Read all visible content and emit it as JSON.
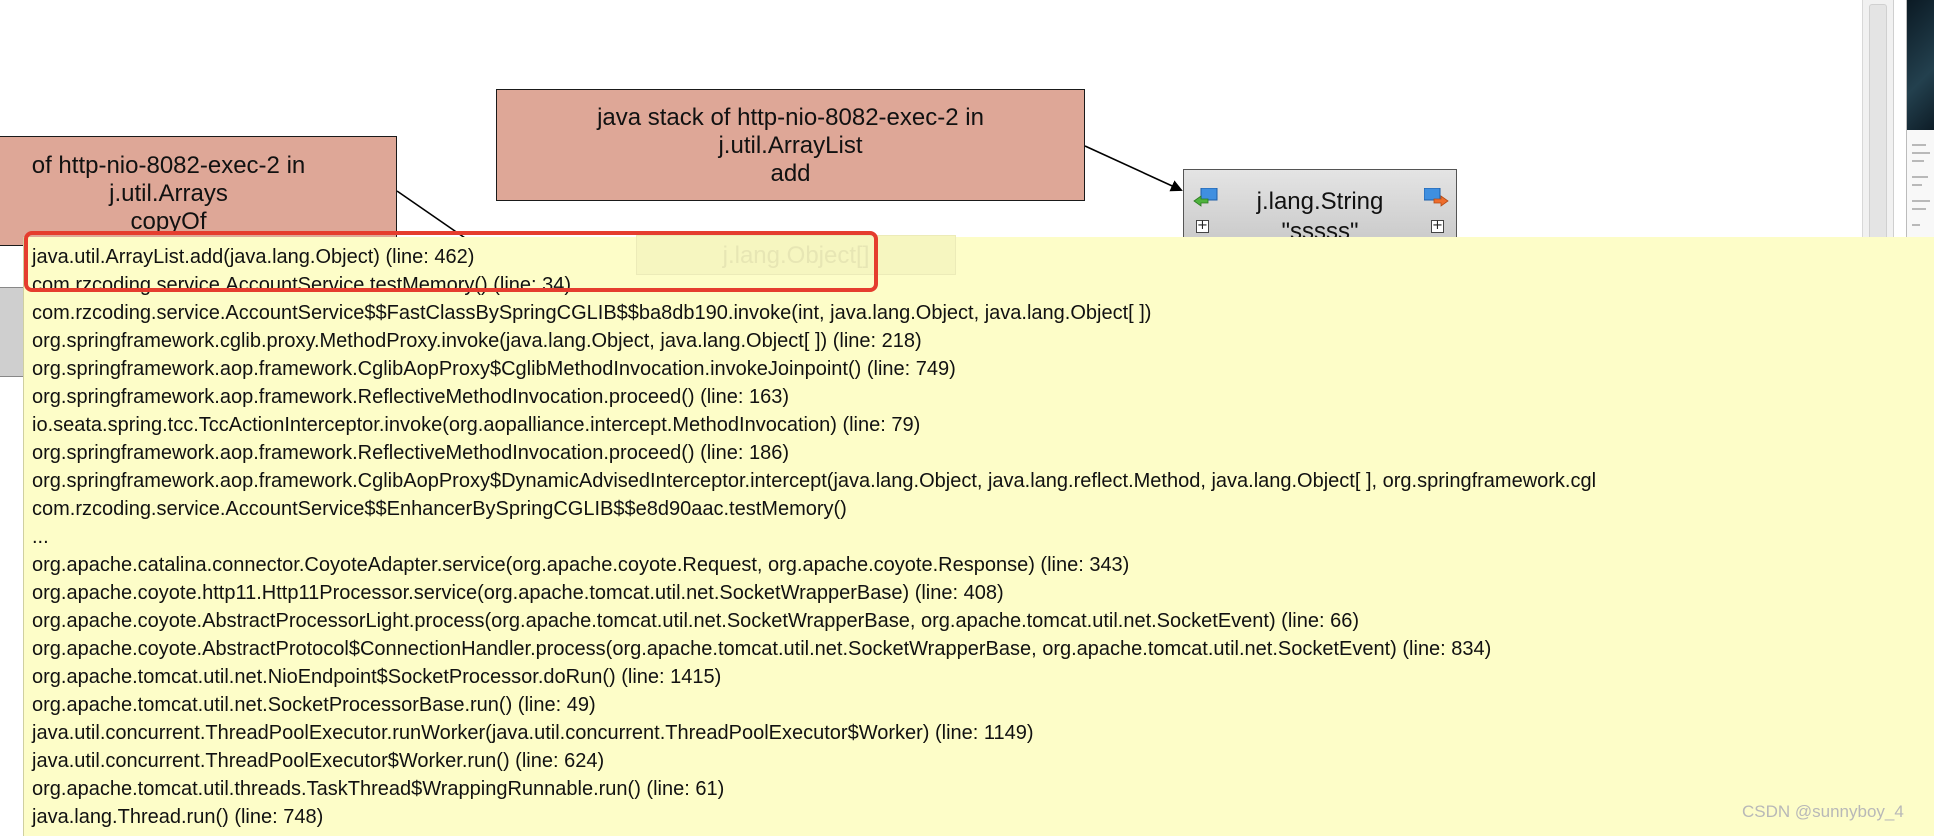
{
  "graph": {
    "stack_nodes": [
      {
        "lines": [
          "of http-nio-8082-exec-2 in",
          "j.util.Arrays",
          "copyOf"
        ]
      },
      {
        "lines": [
          "java stack of http-nio-8082-exec-2 in",
          "j.util.ArrayList",
          "add"
        ]
      }
    ],
    "class_node": {
      "lines": [
        "j.lang.String",
        "\"sssss\""
      ]
    },
    "ghost_node": {
      "label": "j.lang.Object[]"
    }
  },
  "tooltip": {
    "frames": [
      "java.util.ArrayList.add(java.lang.Object) (line: 462)",
      "com.rzcoding.service.AccountService.testMemory() (line: 34)",
      "com.rzcoding.service.AccountService$$FastClassBySpringCGLIB$$ba8db190.invoke(int, java.lang.Object, java.lang.Object[ ])",
      "org.springframework.cglib.proxy.MethodProxy.invoke(java.lang.Object, java.lang.Object[ ]) (line: 218)",
      "org.springframework.aop.framework.CglibAopProxy$CglibMethodInvocation.invokeJoinpoint() (line: 749)",
      "org.springframework.aop.framework.ReflectiveMethodInvocation.proceed() (line: 163)",
      "io.seata.spring.tcc.TccActionInterceptor.invoke(org.aopalliance.intercept.MethodInvocation) (line: 79)",
      "org.springframework.aop.framework.ReflectiveMethodInvocation.proceed() (line: 186)",
      "org.springframework.aop.framework.CglibAopProxy$DynamicAdvisedInterceptor.intercept(java.lang.Object, java.lang.reflect.Method, java.lang.Object[ ], org.springframework.cgl",
      "com.rzcoding.service.AccountService$$EnhancerBySpringCGLIB$$e8d90aac.testMemory()",
      "...",
      "org.apache.catalina.connector.CoyoteAdapter.service(org.apache.coyote.Request, org.apache.coyote.Response) (line: 343)",
      "org.apache.coyote.http11.Http11Processor.service(org.apache.tomcat.util.net.SocketWrapperBase) (line: 408)",
      "org.apache.coyote.AbstractProcessorLight.process(org.apache.tomcat.util.net.SocketWrapperBase, org.apache.tomcat.util.net.SocketEvent) (line: 66)",
      "org.apache.coyote.AbstractProtocol$ConnectionHandler.process(org.apache.tomcat.util.net.SocketWrapperBase, org.apache.tomcat.util.net.SocketEvent) (line: 834)",
      "org.apache.tomcat.util.net.NioEndpoint$SocketProcessor.doRun() (line: 1415)",
      "org.apache.tomcat.util.net.SocketProcessorBase.run() (line: 49)",
      "java.util.concurrent.ThreadPoolExecutor.runWorker(java.util.concurrent.ThreadPoolExecutor$Worker) (line: 1149)",
      "java.util.concurrent.ThreadPoolExecutor$Worker.run() (line: 624)",
      "org.apache.tomcat.util.threads.TaskThread$WrappingRunnable.run() (line: 61)",
      "java.lang.Thread.run() (line: 748)"
    ]
  },
  "watermark": "CSDN @sunnyboy_4",
  "icons": {
    "navigate_left": "navigate-left-icon",
    "navigate_right": "navigate-right-icon",
    "expand": "expand-plus-icon"
  },
  "colors": {
    "stack_node_fill": "#dea797",
    "class_node_fill": "#d4d4d4",
    "tooltip_bg": "#fdfdc8",
    "highlight_border": "#e53d2e"
  }
}
